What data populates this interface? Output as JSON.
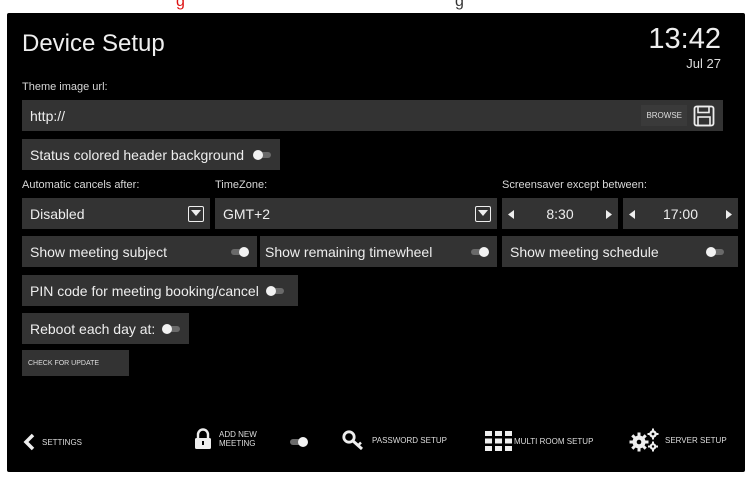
{
  "header": {
    "title": "Device Setup",
    "time": "13:42",
    "date": "Jul 27"
  },
  "theme": {
    "label": "Theme image url:",
    "value": "http://",
    "browse_label": "BROWSE"
  },
  "status_header": {
    "label": "Status colored header background",
    "toggle": "off"
  },
  "labels": {
    "auto_cancel": "Automatic cancels after:",
    "timezone": "TimeZone:",
    "screensaver": "Screensaver except between:"
  },
  "auto_cancel": {
    "value": "Disabled"
  },
  "timezone": {
    "value": "GMT+2"
  },
  "screensaver": {
    "start": "8:30",
    "end": "17:00"
  },
  "toggles": {
    "meeting_subject": {
      "label": "Show meeting subject",
      "state": "on"
    },
    "remaining_timewheel": {
      "label": "Show remaining timewheel",
      "state": "on"
    },
    "meeting_schedule": {
      "label": "Show meeting schedule",
      "state": "off"
    },
    "pin_code": {
      "label": "PIN code for meeting booking/cancel",
      "state": "off"
    },
    "reboot": {
      "label": "Reboot each day at:",
      "state": "off"
    }
  },
  "update_button": {
    "label": "CHECK FOR UPDATE"
  },
  "footer": {
    "settings": "SETTINGS",
    "add_new": "ADD NEW",
    "meeting": "MEETING",
    "password": "PASSWORD SETUP",
    "multiroom": "MULTI ROOM SETUP",
    "server": "SERVER SETUP",
    "add_meeting_toggle": "on"
  },
  "topbar": {
    "fragment_red": "g",
    "fragment_dark": "g"
  },
  "colors": {
    "background": "#000000",
    "panel": "#333333",
    "text": "#e6e6e6",
    "toggle_knob": "#f2f2f2"
  }
}
